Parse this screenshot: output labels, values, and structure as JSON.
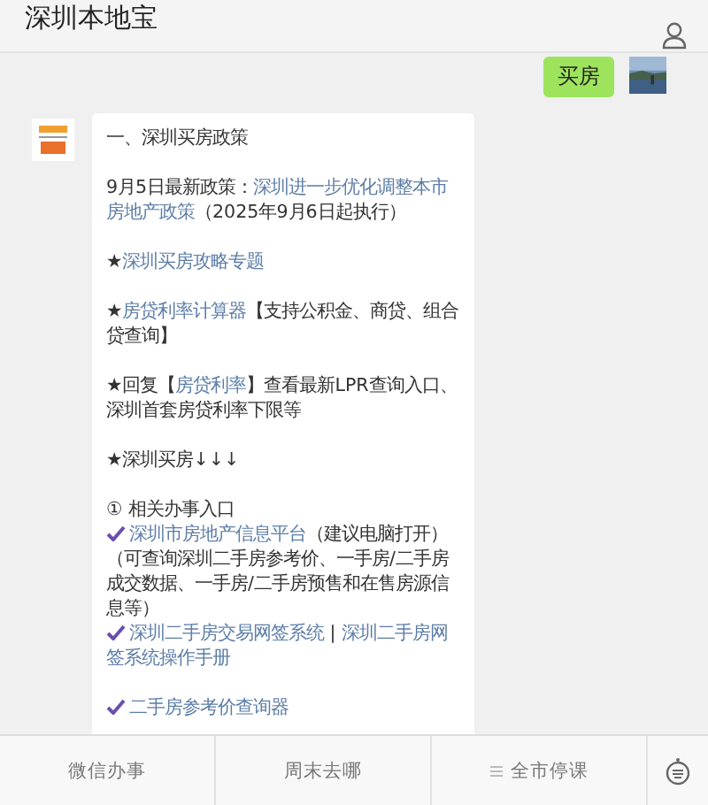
{
  "header": {
    "title": "深圳本地宝"
  },
  "sent": {
    "text": "买房"
  },
  "received": {
    "paragraphs": [
      {
        "lines": [
          {
            "check": false,
            "segments": [
              {
                "kind": "plain",
                "text": "一、深圳买房政策"
              }
            ]
          }
        ]
      },
      {
        "lines": [
          {
            "check": false,
            "segments": [
              {
                "kind": "plain",
                "text": "9月5日最新政策："
              },
              {
                "kind": "link",
                "text": "深圳进一步优化调整本市"
              },
              {
                "kind": "link",
                "text": "房地产政策"
              },
              {
                "kind": "plain",
                "text": "（2025年9月6日起执行）"
              }
            ]
          }
        ]
      },
      {
        "lines": [
          {
            "check": false,
            "segments": [
              {
                "kind": "plain",
                "text": "★"
              },
              {
                "kind": "link",
                "text": "深圳买房攻略专题"
              }
            ]
          }
        ]
      },
      {
        "lines": [
          {
            "check": false,
            "segments": [
              {
                "kind": "plain",
                "text": "★"
              },
              {
                "kind": "link",
                "text": "房贷利率计算器"
              },
              {
                "kind": "plain",
                "text": "【支持公积金、商贷、组合贷查询】"
              }
            ]
          }
        ]
      },
      {
        "lines": [
          {
            "check": false,
            "segments": [
              {
                "kind": "plain",
                "text": "★回复【"
              },
              {
                "kind": "link",
                "text": "房贷利率"
              },
              {
                "kind": "plain",
                "text": "】查看最新LPR查询入口、深圳首套房贷利率下限等"
              }
            ]
          }
        ]
      },
      {
        "lines": [
          {
            "check": false,
            "segments": [
              {
                "kind": "plain",
                "text": "★深圳买房↓↓↓"
              }
            ]
          }
        ]
      },
      {
        "lines": [
          {
            "check": false,
            "segments": [
              {
                "kind": "plain",
                "text": "① 相关办事入口"
              }
            ]
          },
          {
            "check": true,
            "segments": [
              {
                "kind": "link",
                "text": "深圳市房地产信息平台"
              },
              {
                "kind": "plain",
                "text": "（建议电脑打开）（可查询深圳二手房参考价、一手房/二手房成交数据、一手房/二手房预售和在售房源信息等）"
              }
            ]
          },
          {
            "check": true,
            "segments": [
              {
                "kind": "link",
                "text": "深圳二手房交易网签系统"
              },
              {
                "kind": "plain",
                "text": " | "
              },
              {
                "kind": "link",
                "text": "深圳二手房网"
              },
              {
                "kind": "link",
                "text": "签系统操作手册"
              }
            ]
          }
        ]
      },
      {
        "lines": [
          {
            "check": true,
            "segments": [
              {
                "kind": "link",
                "text": "二手房参考价查询器"
              }
            ]
          }
        ]
      }
    ]
  },
  "menu": {
    "items": [
      {
        "label": "微信办事",
        "submenu": false
      },
      {
        "label": "周末去哪",
        "submenu": false
      },
      {
        "label": "全市停课",
        "submenu": true
      }
    ]
  }
}
